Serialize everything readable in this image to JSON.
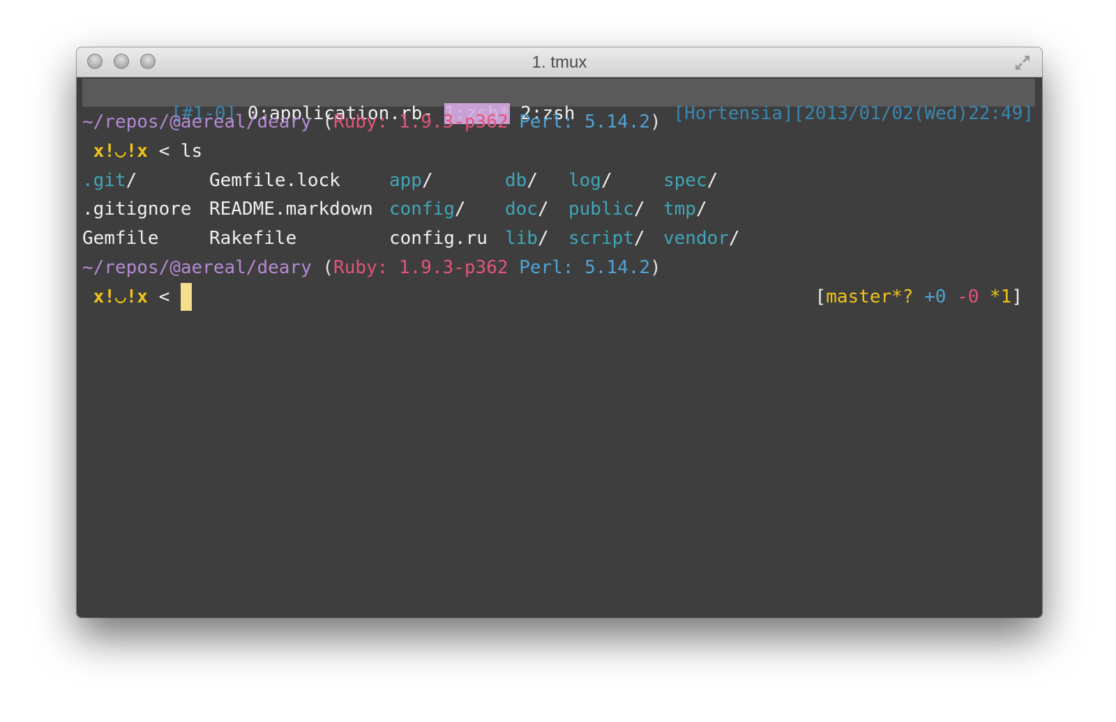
{
  "window": {
    "title": "1. tmux"
  },
  "statusbar": {
    "session": "[#1-0]",
    "windows": [
      {
        "label": "0:application.rb-"
      },
      {
        "label": "1:zsh*"
      },
      {
        "label": "2:zsh"
      }
    ],
    "right": "[Hortensia][2013/01/02(Wed)22:49]"
  },
  "prompt_info": {
    "path": "~/repos/@aereal/deary",
    "open_paren": "(",
    "ruby_label": "Ruby:",
    "ruby_version": "1.9.3-p362",
    "perl_label": "Perl:",
    "perl_version": "5.14.2",
    "close_paren": ")"
  },
  "prompt": {
    "face": "x!◡!x",
    "symbol": "<",
    "command": "ls"
  },
  "listing": {
    "rows": [
      [
        {
          "name": ".git",
          "dir": true
        },
        {
          "name": "Gemfile.lock",
          "dir": false
        },
        {
          "name": "app",
          "dir": true
        },
        {
          "name": "db",
          "dir": true
        },
        {
          "name": "log",
          "dir": true
        },
        {
          "name": "spec",
          "dir": true
        }
      ],
      [
        {
          "name": ".gitignore",
          "dir": false
        },
        {
          "name": "README.markdown",
          "dir": false
        },
        {
          "name": "config",
          "dir": true
        },
        {
          "name": "doc",
          "dir": true
        },
        {
          "name": "public",
          "dir": true
        },
        {
          "name": "tmp",
          "dir": true
        }
      ],
      [
        {
          "name": "Gemfile",
          "dir": false
        },
        {
          "name": "Rakefile",
          "dir": false
        },
        {
          "name": "config.ru",
          "dir": false
        },
        {
          "name": "lib",
          "dir": true
        },
        {
          "name": "script",
          "dir": true
        },
        {
          "name": "vendor",
          "dir": true
        }
      ]
    ],
    "dir_suffix": "/"
  },
  "git_status": {
    "open": "[",
    "branch": "master*?",
    "added": "+0",
    "deleted": "-0",
    "modified": "*1",
    "close": "]"
  },
  "colors": {
    "terminal_bg": "#3e3e3e",
    "path": "#b58ad4",
    "ruby": "#e3547a",
    "perl": "#4ea4d6",
    "directory": "#3fa6b8",
    "prompt_face": "#f0c419",
    "cursor": "#f7dd8e"
  },
  "icons": [
    "close-button-icon",
    "minimize-button-icon",
    "zoom-button-icon",
    "fullscreen-icon"
  ]
}
